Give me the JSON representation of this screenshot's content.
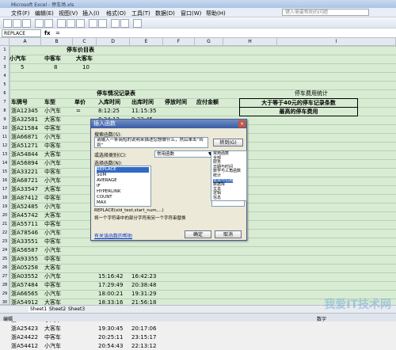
{
  "window": {
    "title": "Microsoft Excel - 停车场.xls"
  },
  "menu": [
    "文件(F)",
    "编辑(E)",
    "视图(V)",
    "插入(I)",
    "格式(O)",
    "工具(T)",
    "数据(D)",
    "窗口(W)",
    "帮助(H)"
  ],
  "help_box": {
    "placeholder": "键入需要帮助的问题"
  },
  "formula_bar": {
    "name_box": "REPLACE",
    "fx": "fx",
    "content": "="
  },
  "columns": [
    "A",
    "B",
    "C",
    "D",
    "E",
    "F",
    "G",
    "H",
    "I"
  ],
  "price_table": {
    "title": "停车价目表",
    "headers": [
      "小汽车",
      "中客车",
      "大客车"
    ],
    "values": [
      "5",
      "8",
      "10"
    ]
  },
  "record_table": {
    "title": "停车情况记录表",
    "headers": [
      "车牌号",
      "车型",
      "单价",
      "入库时间",
      "出库时间",
      "停放时间",
      "应付金额"
    ],
    "rows": [
      [
        "浙A12345",
        "小汽车",
        "=",
        "8:12:25",
        "11:15:35"
      ],
      [
        "浙A32581",
        "大客车",
        "",
        "8:34:12",
        "9:32:45"
      ],
      [
        "浙A21584",
        "中客车",
        "",
        "",
        ""
      ],
      [
        "浙A66871",
        "小汽车",
        "",
        "",
        ""
      ],
      [
        "浙A51271",
        "中客车",
        "",
        "",
        ""
      ],
      [
        "浙A54844",
        "大客车",
        "",
        "",
        ""
      ],
      [
        "浙A56894",
        "小汽车",
        "",
        "",
        ""
      ],
      [
        "浙A33221",
        "中客车",
        "",
        "",
        ""
      ],
      [
        "浙A68721",
        "小汽车",
        "",
        "",
        ""
      ],
      [
        "浙A33547",
        "大客车",
        "",
        "",
        ""
      ],
      [
        "浙A87412",
        "中客车",
        "",
        "",
        ""
      ],
      [
        "浙A52485",
        "小汽车",
        "",
        "",
        ""
      ],
      [
        "浙A45742",
        "大客车",
        "",
        "",
        ""
      ],
      [
        "浙A55711",
        "中客车",
        "",
        "",
        ""
      ],
      [
        "浙A78546",
        "小汽车",
        "",
        "",
        ""
      ],
      [
        "浙A33551",
        "中客车",
        "",
        "",
        ""
      ],
      [
        "浙A56587",
        "小汽车",
        "",
        "",
        ""
      ],
      [
        "浙A93355",
        "中客车",
        "",
        "",
        ""
      ],
      [
        "浙A05258",
        "大客车",
        "",
        "",
        ""
      ],
      [
        "浙A03552",
        "小汽车",
        "",
        "15:16:42",
        "16:42:23"
      ],
      [
        "浙A57484",
        "中客车",
        "",
        "17:29:49",
        "20:38:48"
      ],
      [
        "浙A66565",
        "小汽车",
        "",
        "18:00:21",
        "19:31:29"
      ],
      [
        "浙A54912",
        "大客车",
        "",
        "18:33:16",
        "21:56:18"
      ],
      [
        "浙A56786",
        "中客车",
        "",
        "18:46:48",
        "19:22:45"
      ],
      [
        "浙A94658",
        "小汽车",
        "",
        "19:05:21",
        "19:45:23"
      ],
      [
        "浙A25423",
        "大客车",
        "",
        "19:30:45",
        "20:17:06"
      ],
      [
        "浙A24422",
        "中客车",
        "",
        "20:25:11",
        "23:15:17"
      ],
      [
        "浙A54412",
        "小汽车",
        "",
        "20:54:43",
        "22:13:12"
      ]
    ]
  },
  "stats": {
    "title": "停车费用统计",
    "item1": "大于等于40元的停车记录条数",
    "item2": "最高的停车费用"
  },
  "dialog": {
    "title": "插入函数",
    "search_label": "搜索函数(S):",
    "search_text": "请输入一条简短的说明来描述您想做什么，然后单击“转到”",
    "go_button": "转到(G)",
    "category_label": "或选择类别(C):",
    "category_value": "常用函数",
    "category_options": [
      "常用函数",
      "全部",
      "财务",
      "日期与时间",
      "数学与三角函数",
      "统计",
      "查找与引用",
      "数据库",
      "文本",
      "逻辑",
      "信息"
    ],
    "highlighted_category": "查找与引用",
    "func_label": "选择函数(N):",
    "functions": [
      "REPLACE",
      "SUM",
      "AVERAGE",
      "IF",
      "HYPERLINK",
      "COUNT",
      "MAX"
    ],
    "selected_function": "REPLACE",
    "signature": "REPLACE(old_text,start_num,...)",
    "description": "将一个字符串中的部分字符用另一个字符串替换",
    "help_link": "有关该函数的帮助",
    "ok": "确定",
    "cancel": "取消"
  },
  "sheets": [
    "Sheet1",
    "Sheet2",
    "Sheet3"
  ],
  "status": {
    "left": "编辑",
    "right": "数字"
  },
  "watermark": "我爱IT技术网"
}
